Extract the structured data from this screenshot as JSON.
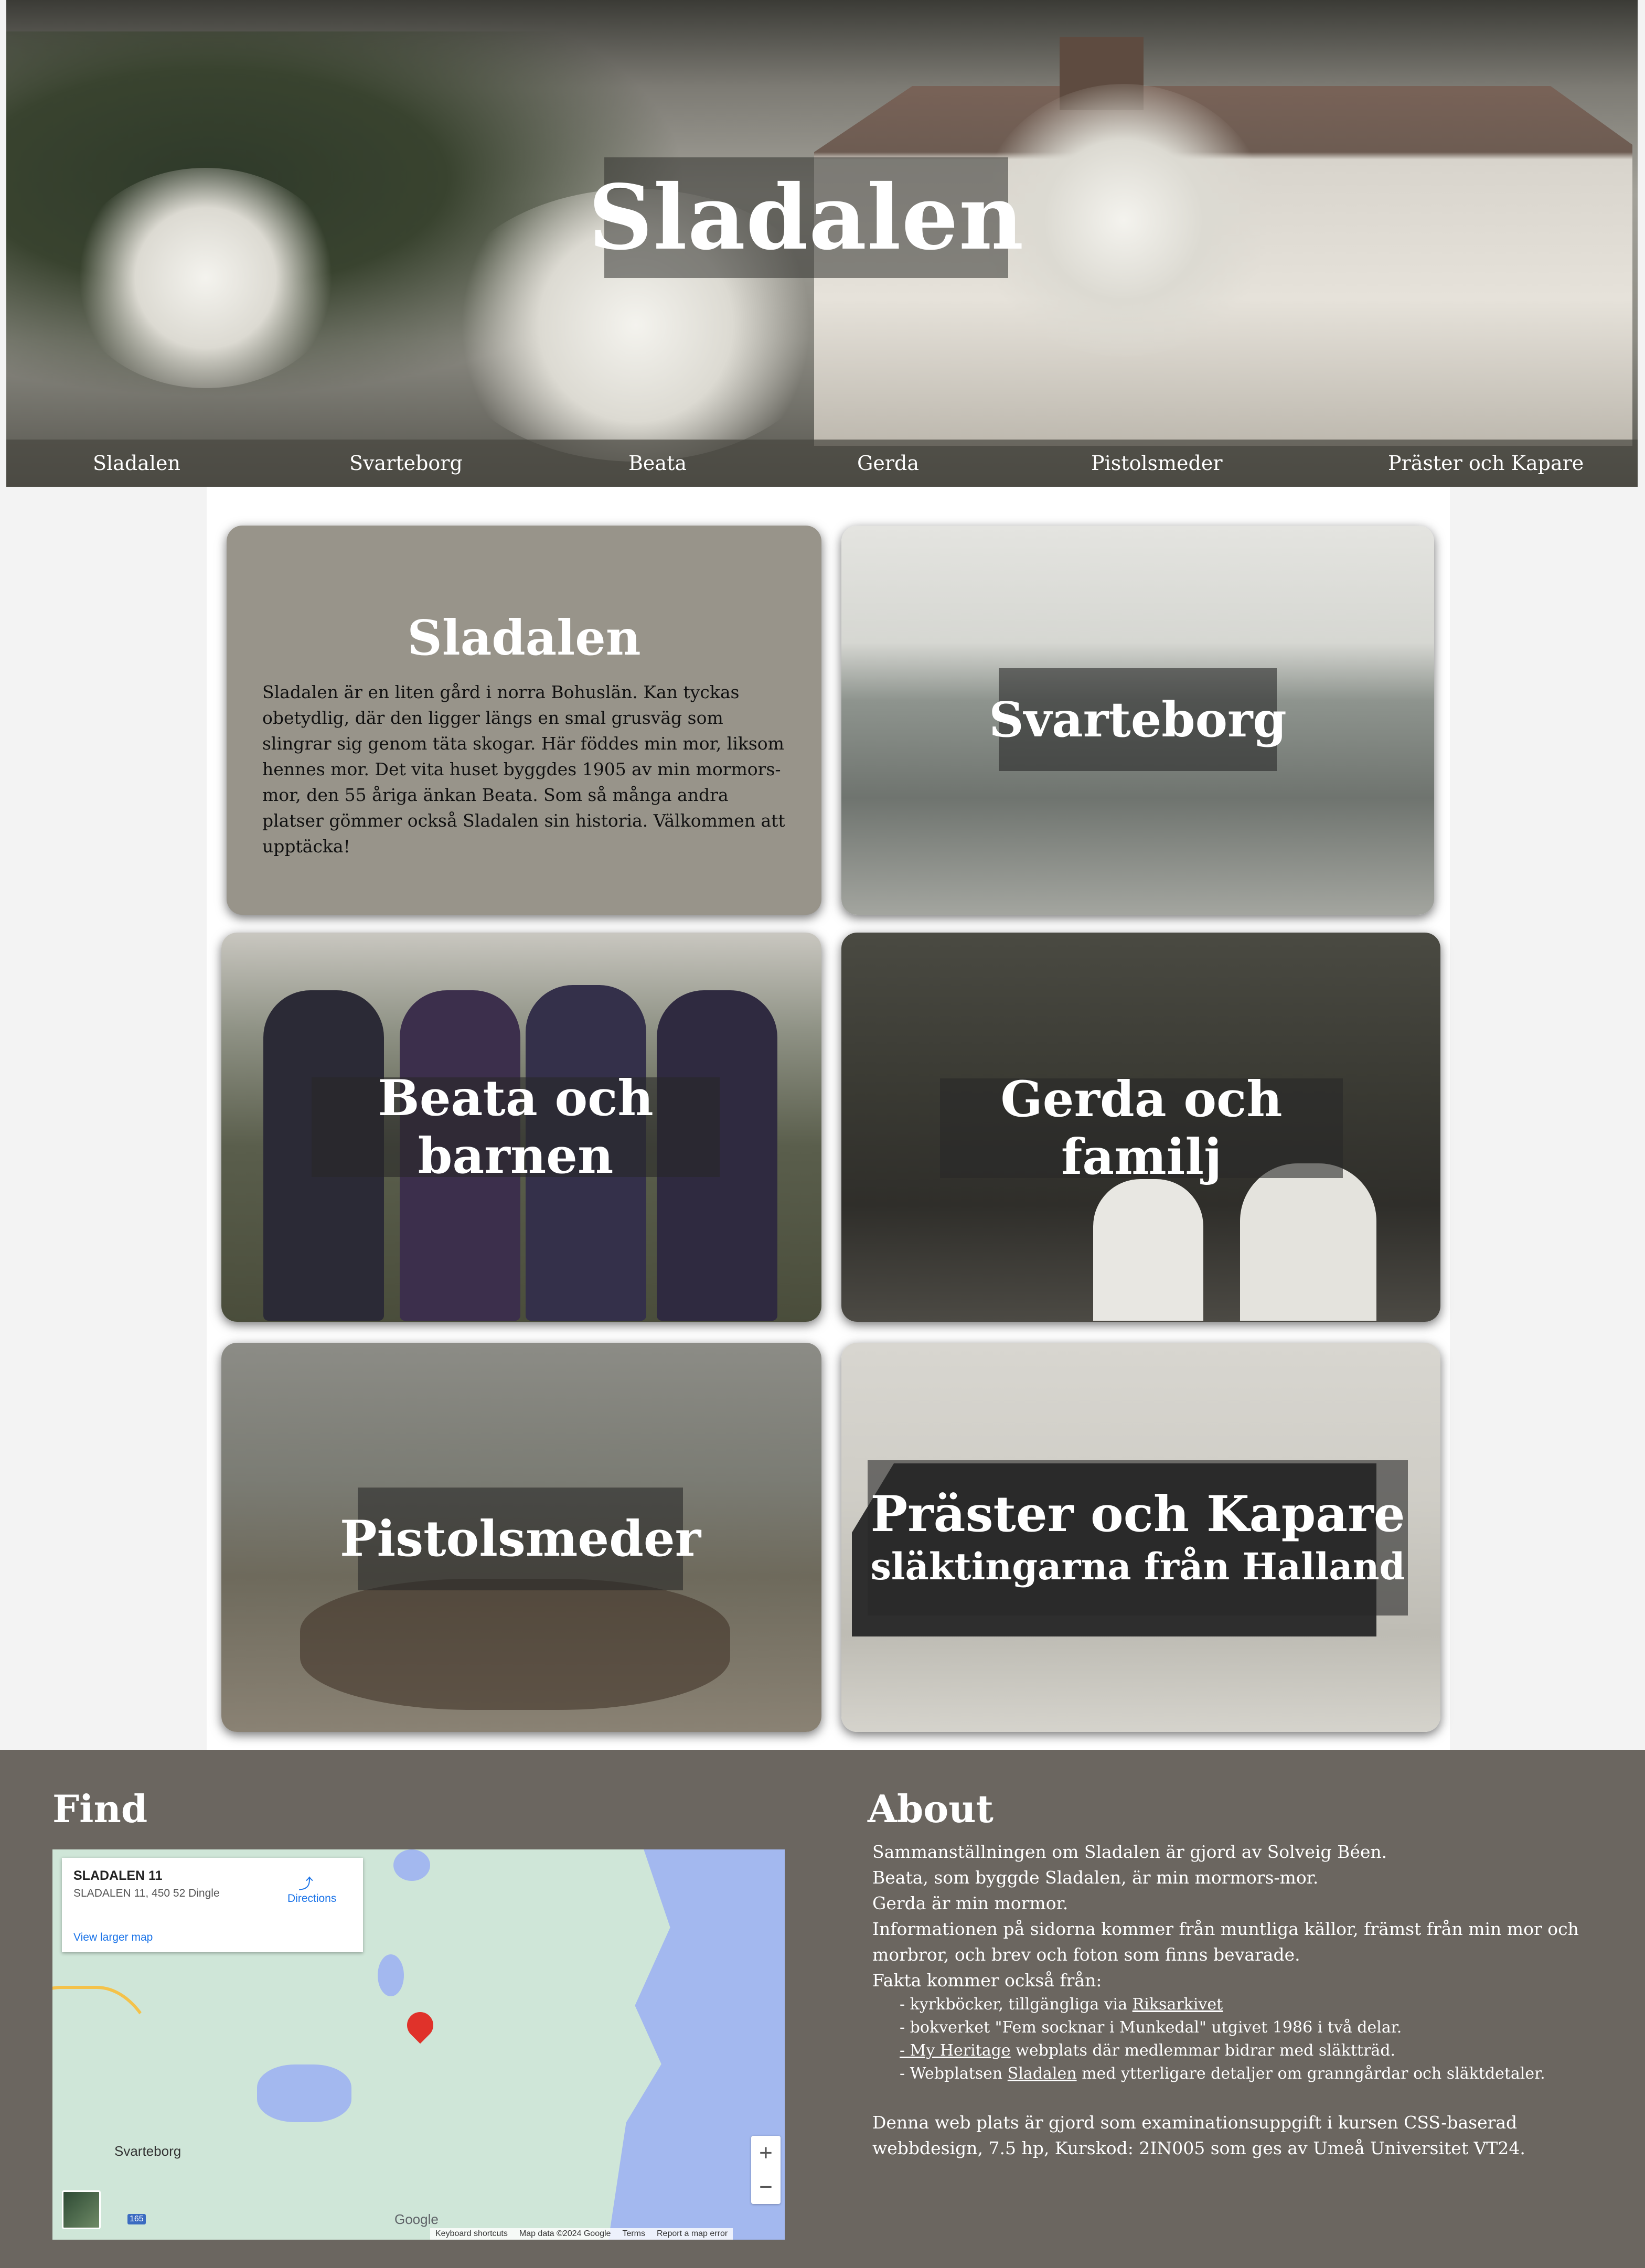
{
  "header": {
    "title": "Sladalen"
  },
  "nav": {
    "items": [
      {
        "label": "Sladalen"
      },
      {
        "label": "Svarteborg"
      },
      {
        "label": "Beata"
      },
      {
        "label": "Gerda"
      },
      {
        "label": "Pistolsmeder"
      },
      {
        "label": "Präster och Kapare"
      }
    ]
  },
  "intro": {
    "title": "Sladalen",
    "text": "Sladalen är en liten gård i norra Bohuslän. Kan tyckas obetydlig, där den ligger längs en smal grusväg som slingrar sig genom täta skogar. Här föddes min mor, liksom hennes mor. Det vita huset byggdes 1905 av min mormors-mor, den 55 åriga änkan Beata. Som så många andra platser gömmer också Sladalen sin historia. Välkommen att upptäcka!"
  },
  "cards": [
    {
      "title": "Svarteborg"
    },
    {
      "title": "Beata och barnen"
    },
    {
      "title": "Gerda och familj"
    },
    {
      "title": "Pistolsmeder"
    },
    {
      "title": "Präster och Kapare",
      "subtitle": "släktingarna från Halland"
    }
  ],
  "footer": {
    "find_heading": "Find",
    "about_heading": "About",
    "map": {
      "place_name": "SLADALEN 11",
      "address": "SLADALEN 11, 450 52 Dingle",
      "directions": "Directions",
      "view_larger": "View larger map",
      "town_label": "Svarteborg",
      "road_number": "165",
      "zoom_in": "+",
      "zoom_out": "−",
      "google": "Google",
      "attribution": [
        "Keyboard shortcuts",
        "Map data ©2024 Google",
        "Terms",
        "Report a map error"
      ]
    },
    "about": {
      "lines": [
        "Sammanställningen om Sladalen är gjord av Solveig Béen.",
        "Beata, som byggde Sladalen, är min mormors-mor.",
        "Gerda är min mormor.",
        "Informationen på sidorna kommer från muntliga källor, främst från min mor och morbror, och brev och foton som finns bevarade.",
        "Fakta kommer också från:"
      ],
      "sources": [
        {
          "pre": "- kyrkböcker, tillgängliga via ",
          "link": "Riksarkivet",
          "post": ""
        },
        {
          "pre": "- bokverket \"Fem socknar i Munkedal\" utgivet 1986 i två delar.",
          "link": "",
          "post": ""
        },
        {
          "pre": "",
          "link": "- My Heritage",
          "post": " webplats där medlemmar bidrar med släktträd."
        },
        {
          "pre": "- Webplatsen ",
          "link": "Sladalen",
          "post": " med ytterligare detaljer om granngårdar och släktdetaler."
        }
      ],
      "closing": "Denna web plats är gjord som examinationsuppgift i kursen CSS-baserad webbdesign, 7.5 hp, Kurskod: 2IN005 som ges av Umeå Universitet VT24."
    }
  }
}
